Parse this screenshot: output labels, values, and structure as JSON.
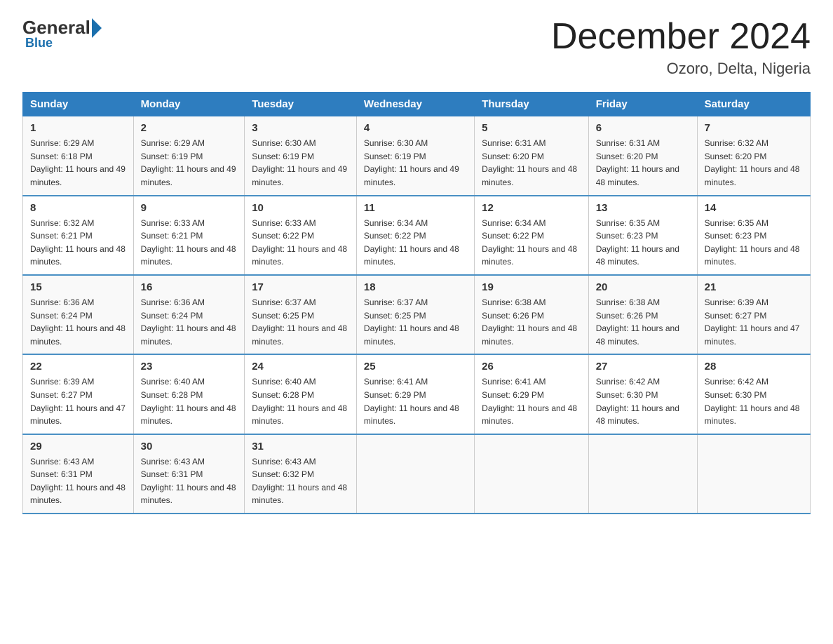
{
  "header": {
    "logo_general": "General",
    "logo_blue": "Blue",
    "month": "December 2024",
    "location": "Ozoro, Delta, Nigeria"
  },
  "days_of_week": [
    "Sunday",
    "Monday",
    "Tuesday",
    "Wednesday",
    "Thursday",
    "Friday",
    "Saturday"
  ],
  "weeks": [
    [
      {
        "day": "1",
        "sunrise": "6:29 AM",
        "sunset": "6:18 PM",
        "daylight": "11 hours and 49 minutes."
      },
      {
        "day": "2",
        "sunrise": "6:29 AM",
        "sunset": "6:19 PM",
        "daylight": "11 hours and 49 minutes."
      },
      {
        "day": "3",
        "sunrise": "6:30 AM",
        "sunset": "6:19 PM",
        "daylight": "11 hours and 49 minutes."
      },
      {
        "day": "4",
        "sunrise": "6:30 AM",
        "sunset": "6:19 PM",
        "daylight": "11 hours and 49 minutes."
      },
      {
        "day": "5",
        "sunrise": "6:31 AM",
        "sunset": "6:20 PM",
        "daylight": "11 hours and 48 minutes."
      },
      {
        "day": "6",
        "sunrise": "6:31 AM",
        "sunset": "6:20 PM",
        "daylight": "11 hours and 48 minutes."
      },
      {
        "day": "7",
        "sunrise": "6:32 AM",
        "sunset": "6:20 PM",
        "daylight": "11 hours and 48 minutes."
      }
    ],
    [
      {
        "day": "8",
        "sunrise": "6:32 AM",
        "sunset": "6:21 PM",
        "daylight": "11 hours and 48 minutes."
      },
      {
        "day": "9",
        "sunrise": "6:33 AM",
        "sunset": "6:21 PM",
        "daylight": "11 hours and 48 minutes."
      },
      {
        "day": "10",
        "sunrise": "6:33 AM",
        "sunset": "6:22 PM",
        "daylight": "11 hours and 48 minutes."
      },
      {
        "day": "11",
        "sunrise": "6:34 AM",
        "sunset": "6:22 PM",
        "daylight": "11 hours and 48 minutes."
      },
      {
        "day": "12",
        "sunrise": "6:34 AM",
        "sunset": "6:22 PM",
        "daylight": "11 hours and 48 minutes."
      },
      {
        "day": "13",
        "sunrise": "6:35 AM",
        "sunset": "6:23 PM",
        "daylight": "11 hours and 48 minutes."
      },
      {
        "day": "14",
        "sunrise": "6:35 AM",
        "sunset": "6:23 PM",
        "daylight": "11 hours and 48 minutes."
      }
    ],
    [
      {
        "day": "15",
        "sunrise": "6:36 AM",
        "sunset": "6:24 PM",
        "daylight": "11 hours and 48 minutes."
      },
      {
        "day": "16",
        "sunrise": "6:36 AM",
        "sunset": "6:24 PM",
        "daylight": "11 hours and 48 minutes."
      },
      {
        "day": "17",
        "sunrise": "6:37 AM",
        "sunset": "6:25 PM",
        "daylight": "11 hours and 48 minutes."
      },
      {
        "day": "18",
        "sunrise": "6:37 AM",
        "sunset": "6:25 PM",
        "daylight": "11 hours and 48 minutes."
      },
      {
        "day": "19",
        "sunrise": "6:38 AM",
        "sunset": "6:26 PM",
        "daylight": "11 hours and 48 minutes."
      },
      {
        "day": "20",
        "sunrise": "6:38 AM",
        "sunset": "6:26 PM",
        "daylight": "11 hours and 48 minutes."
      },
      {
        "day": "21",
        "sunrise": "6:39 AM",
        "sunset": "6:27 PM",
        "daylight": "11 hours and 47 minutes."
      }
    ],
    [
      {
        "day": "22",
        "sunrise": "6:39 AM",
        "sunset": "6:27 PM",
        "daylight": "11 hours and 47 minutes."
      },
      {
        "day": "23",
        "sunrise": "6:40 AM",
        "sunset": "6:28 PM",
        "daylight": "11 hours and 48 minutes."
      },
      {
        "day": "24",
        "sunrise": "6:40 AM",
        "sunset": "6:28 PM",
        "daylight": "11 hours and 48 minutes."
      },
      {
        "day": "25",
        "sunrise": "6:41 AM",
        "sunset": "6:29 PM",
        "daylight": "11 hours and 48 minutes."
      },
      {
        "day": "26",
        "sunrise": "6:41 AM",
        "sunset": "6:29 PM",
        "daylight": "11 hours and 48 minutes."
      },
      {
        "day": "27",
        "sunrise": "6:42 AM",
        "sunset": "6:30 PM",
        "daylight": "11 hours and 48 minutes."
      },
      {
        "day": "28",
        "sunrise": "6:42 AM",
        "sunset": "6:30 PM",
        "daylight": "11 hours and 48 minutes."
      }
    ],
    [
      {
        "day": "29",
        "sunrise": "6:43 AM",
        "sunset": "6:31 PM",
        "daylight": "11 hours and 48 minutes."
      },
      {
        "day": "30",
        "sunrise": "6:43 AM",
        "sunset": "6:31 PM",
        "daylight": "11 hours and 48 minutes."
      },
      {
        "day": "31",
        "sunrise": "6:43 AM",
        "sunset": "6:32 PM",
        "daylight": "11 hours and 48 minutes."
      },
      null,
      null,
      null,
      null
    ]
  ]
}
